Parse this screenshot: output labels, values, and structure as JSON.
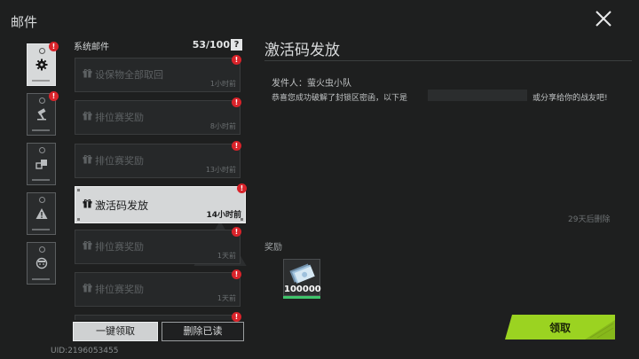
{
  "window": {
    "title": "邮件"
  },
  "list": {
    "header_label": "系统邮件",
    "count": "53/100",
    "help": "?"
  },
  "categories": [
    {
      "name": "system",
      "icon": "gear-icon",
      "badge": "!",
      "active": true
    },
    {
      "name": "guild",
      "icon": "hammer-icon",
      "badge": "!",
      "active": false
    },
    {
      "name": "trade",
      "icon": "boxes-icon",
      "badge": "",
      "active": false
    },
    {
      "name": "warning",
      "icon": "warning-icon",
      "badge": "",
      "active": false
    },
    {
      "name": "player",
      "icon": "face-icon",
      "badge": "",
      "active": false
    }
  ],
  "mails": [
    {
      "subject": "设保物全部取回",
      "time": "1小时前",
      "badge": "!"
    },
    {
      "subject": "排位赛奖励",
      "time": "8小时前",
      "badge": "!"
    },
    {
      "subject": "排位赛奖励",
      "time": "13小时前",
      "badge": "!"
    },
    {
      "subject": "激活码发放",
      "time": "14小时前",
      "badge": "!"
    },
    {
      "subject": "排位赛奖励",
      "time": "1天前",
      "badge": "!"
    },
    {
      "subject": "排位赛奖励",
      "time": "1天前",
      "badge": "!"
    },
    {
      "subject": "",
      "time": "",
      "badge": "!"
    }
  ],
  "buttons": {
    "claim_all": "一键领取",
    "delete_read": "删除已读",
    "claim": "领取"
  },
  "uid": "UID:2196053455",
  "detail": {
    "title": "激活码发放",
    "sender": "发件人：萤火虫小队",
    "body_left": "恭喜您成功破解了封锁区密函，以下是",
    "body_right": "或分享给你的战友吧!",
    "expire": "29天后删除",
    "reward_label": "奖励",
    "reward_qty": "100000"
  },
  "colors": {
    "background": "#1e1f1f",
    "badge_red": "#d9232a",
    "claim_green": "#9bd321",
    "reward_green": "#3fc46a"
  }
}
